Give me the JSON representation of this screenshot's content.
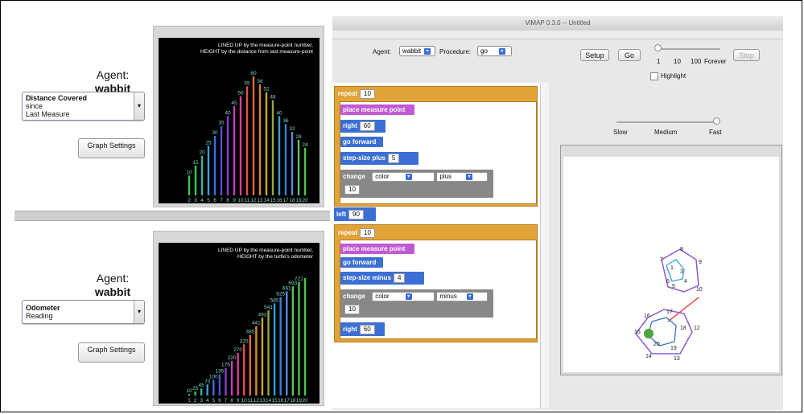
{
  "left_top": {
    "agent_label": "Agent:",
    "agent_name": "wabbit",
    "measure_dropdown": {
      "line1": "Distance Covered",
      "line2": "since",
      "line3": "Last Measure"
    },
    "graph_settings_label": "Graph Settings",
    "graph_title_line1": "LINED UP by the measure-point number,",
    "graph_title_line2": "HEIGHT by the distance from last measure-point",
    "bars": [
      {
        "n": "2",
        "v": 10,
        "c": "#3cc64c"
      },
      {
        "n": "3",
        "v": 15,
        "c": "#3cc64c"
      },
      {
        "n": "4",
        "v": 20,
        "c": "#32b4a0"
      },
      {
        "n": "5",
        "v": 25,
        "c": "#3aa0d8"
      },
      {
        "n": "6",
        "v": 30,
        "c": "#3a70d8"
      },
      {
        "n": "7",
        "v": 35,
        "c": "#5a50d0"
      },
      {
        "n": "8",
        "v": 40,
        "c": "#8a40c8"
      },
      {
        "n": "9",
        "v": 45,
        "c": "#c040b8"
      },
      {
        "n": "10",
        "v": 50,
        "c": "#d8409a"
      },
      {
        "n": "11",
        "v": 55,
        "c": "#e05050"
      },
      {
        "n": "12",
        "v": 60,
        "c": "#e06a40"
      },
      {
        "n": "13",
        "v": 56,
        "c": "#d88a30"
      },
      {
        "n": "14",
        "v": 52,
        "c": "#c8a830"
      },
      {
        "n": "15",
        "v": 48,
        "c": "#9aa63a"
      },
      {
        "n": "16",
        "v": 40,
        "c": "#30a0d0"
      },
      {
        "n": "17",
        "v": 36,
        "c": "#3a80d8"
      },
      {
        "n": "18",
        "v": 32,
        "c": "#5a8ae0"
      },
      {
        "n": "19",
        "v": 28,
        "c": "#60c060"
      },
      {
        "n": "20",
        "v": 24,
        "c": "#44c844"
      }
    ],
    "bar_labels": [
      "10",
      "15",
      "20",
      "25",
      "30",
      "35",
      "40",
      "45",
      "50",
      "55",
      "60",
      "56",
      "52",
      "48",
      "40",
      "36",
      "32",
      "28",
      "24"
    ],
    "axis_labels": [
      "2",
      "3",
      "4",
      "5",
      "6",
      "7",
      "8",
      "9",
      "10",
      "11",
      "12",
      "13",
      "14",
      "15",
      "16",
      "17",
      "18",
      "19",
      "20"
    ]
  },
  "left_bottom": {
    "agent_label": "Agent:",
    "agent_name": "wabbit",
    "measure_dropdown": {
      "line1": "Odometer",
      "line2": "Reading"
    },
    "graph_settings_label": "Graph Settings",
    "graph_title_line1": "LINED UP by the measure-point number,",
    "graph_title_line2": "HEIGHT by the turtle's odometer",
    "bars": [
      {
        "n": "1",
        "v": 10,
        "c": "#3cc64c"
      },
      {
        "n": "2",
        "v": 25,
        "c": "#3cc64c"
      },
      {
        "n": "3",
        "v": 45,
        "c": "#32b4a0"
      },
      {
        "n": "4",
        "v": 70,
        "c": "#3aa0d8"
      },
      {
        "n": "5",
        "v": 100,
        "c": "#3a70d8"
      },
      {
        "n": "6",
        "v": 135,
        "c": "#5a50d0"
      },
      {
        "n": "7",
        "v": 175,
        "c": "#8a40c8"
      },
      {
        "n": "8",
        "v": 220,
        "c": "#c040b8"
      },
      {
        "n": "9",
        "v": 270,
        "c": "#d8409a"
      },
      {
        "n": "10",
        "v": 325,
        "c": "#e05050"
      },
      {
        "n": "11",
        "v": 385,
        "c": "#e06a40"
      },
      {
        "n": "12",
        "v": 441,
        "c": "#d88a30"
      },
      {
        "n": "13",
        "v": 493,
        "c": "#c8a830"
      },
      {
        "n": "14",
        "v": 541,
        "c": "#9aa63a"
      },
      {
        "n": "15",
        "v": 585,
        "c": "#30a0d0"
      },
      {
        "n": "16",
        "v": 625,
        "c": "#3a80d8"
      },
      {
        "n": "17",
        "v": 661,
        "c": "#5a8ae0"
      },
      {
        "n": "18",
        "v": 693,
        "c": "#60c060"
      },
      {
        "n": "19",
        "v": 721,
        "c": "#44c844"
      },
      {
        "n": "20",
        "v": 745,
        "c": "#44c844"
      }
    ],
    "bar_labels": [
      "10",
      "25",
      "45",
      "70",
      "100",
      "135",
      "175",
      "220",
      "270",
      "325",
      "385",
      "441",
      "493",
      "541",
      "585",
      "625",
      "661",
      "693",
      "721"
    ],
    "axis_labels": [
      "1",
      "2",
      "3",
      "4",
      "5",
      "6",
      "7",
      "8",
      "9",
      "10",
      "11",
      "12",
      "13",
      "14",
      "15",
      "16",
      "17",
      "18",
      "19",
      "20"
    ]
  },
  "vimap": {
    "title": "ViMAP 0.3.0 -- Untitled",
    "agent_label": "Agent:",
    "agent_value": "wabbit",
    "procedure_label": "Procedure:",
    "procedure_value": "go",
    "setup_label": "Setup",
    "go_label": "Go",
    "stop_label": "Stop",
    "speed_ticks": [
      "1",
      "10",
      "100",
      "Forever"
    ],
    "highlight_label": "Highlight",
    "slow_label": "Slow",
    "medium_label": "Medium",
    "fast_label": "Fast",
    "blocks": {
      "repeat1": {
        "label": "repeat",
        "value": "10"
      },
      "place1": "place measure point",
      "right1": {
        "label": "right",
        "value": "60"
      },
      "forward1": "go forward",
      "stepplus": {
        "label": "step-size plus",
        "value": "5"
      },
      "change1": {
        "label": "change",
        "attr": "color",
        "op": "plus",
        "value": "10"
      },
      "left": {
        "label": "left",
        "value": "90"
      },
      "repeat2": {
        "label": "repeat",
        "value": "10"
      },
      "place2": "place measure point",
      "forward2": "go forward",
      "stepminus": {
        "label": "step-size minus",
        "value": "4"
      },
      "change2": {
        "label": "change",
        "attr": "color",
        "op": "minus",
        "value": "10"
      },
      "right2": {
        "label": "right",
        "value": "60"
      }
    },
    "hex_labels_top": [
      "7",
      "8",
      "9",
      "1",
      "3",
      "4",
      "6",
      "5",
      "10"
    ],
    "hex_labels_bottom": [
      "16",
      "17",
      "18",
      "12",
      "15",
      "20",
      "19",
      "14",
      "13"
    ]
  }
}
